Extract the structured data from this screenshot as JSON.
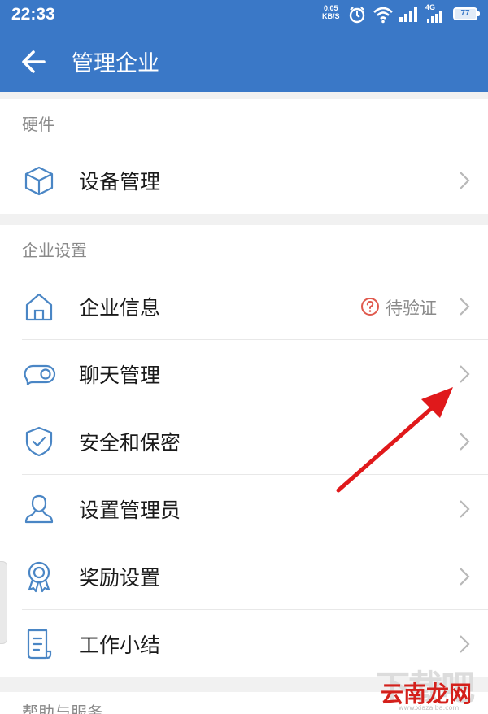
{
  "status_bar": {
    "time": "22:33",
    "speed_value": "0.05",
    "speed_unit": "KB/S",
    "network": "4G",
    "battery": "77"
  },
  "app_bar": {
    "title": "管理企业"
  },
  "sections": [
    {
      "header": "硬件",
      "items": [
        {
          "label": "设备管理",
          "icon": "cube-icon"
        }
      ]
    },
    {
      "header": "企业设置",
      "items": [
        {
          "label": "企业信息",
          "icon": "home-icon",
          "status": "待验证"
        },
        {
          "label": "聊天管理",
          "icon": "toggle-chat-icon"
        },
        {
          "label": "安全和保密",
          "icon": "shield-check-icon"
        },
        {
          "label": "设置管理员",
          "icon": "person-icon"
        },
        {
          "label": "奖励设置",
          "icon": "award-medal-icon"
        },
        {
          "label": "工作小结",
          "icon": "document-icon"
        }
      ]
    },
    {
      "header": "帮助与服务",
      "items": []
    }
  ],
  "watermark": {
    "background_text": "下载吧",
    "brand_text": "云南龙网",
    "url_text": "www.xiazaiba.com"
  },
  "colors": {
    "primary": "#3a78c7",
    "icon_stroke": "#4a86c5",
    "chevron": "#b8b8b8",
    "status_warning": "#e05a4e",
    "annotation_arrow": "#e0191b"
  }
}
